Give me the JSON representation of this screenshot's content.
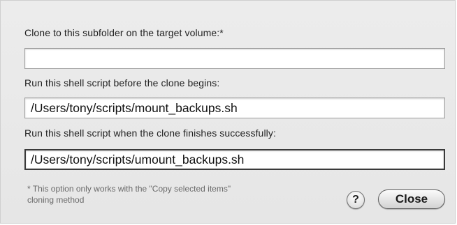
{
  "dialog": {
    "subfolder": {
      "label": "Clone to this subfolder on the target volume:*",
      "value": ""
    },
    "pre_script": {
      "label": "Run this shell script before the clone begins:",
      "value": "/Users/tony/scripts/mount_backups.sh"
    },
    "post_script": {
      "label": "Run this shell script when the clone finishes successfully:",
      "value": "/Users/tony/scripts/umount_backups.sh"
    },
    "footnote": {
      "line1": "* This option only works with the \"Copy selected items\"",
      "line2": "cloning method"
    },
    "help_button": {
      "glyph": "?",
      "icon": "question-mark-icon"
    },
    "close_button": {
      "label": "Close"
    }
  }
}
